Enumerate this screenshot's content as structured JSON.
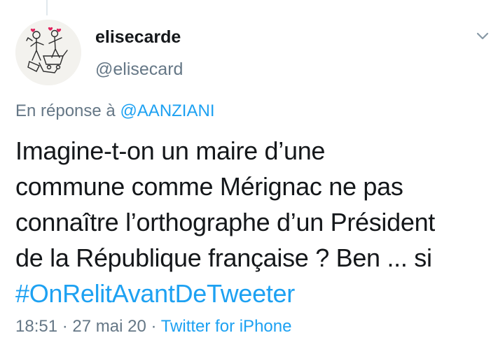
{
  "author": {
    "display_name": "elisecarde",
    "handle": "@elisecard",
    "avatar_icon": "line-drawing-avatar"
  },
  "reply": {
    "prefix": "En réponse à ",
    "mention": "@AANZIANI"
  },
  "tweet": {
    "lines": [
      "Imagine-t-on un maire d’une",
      "commune comme Mérignac ne pas",
      "connaître l’orthographe d’un Président",
      "de la République française ? Ben ... si"
    ],
    "hashtag": "#OnRelitAvantDeTweeter"
  },
  "meta": {
    "time": "18:51",
    "separator": " · ",
    "date": "27 mai 20",
    "source": "Twitter for iPhone"
  },
  "colors": {
    "text": "#14171a",
    "secondary": "#657786",
    "link": "#1da1f2",
    "divider": "#e1e8ed"
  }
}
